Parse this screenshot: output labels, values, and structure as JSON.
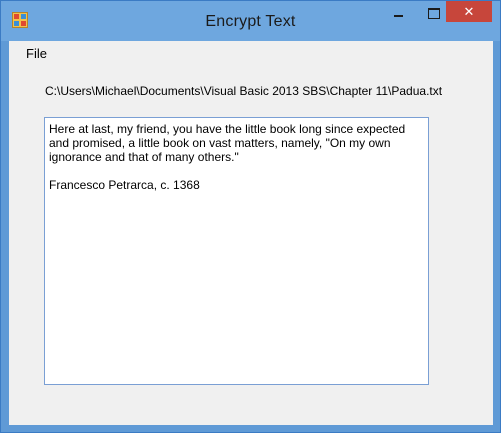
{
  "window": {
    "title": "Encrypt Text",
    "close_glyph": "✕"
  },
  "menu": {
    "items": [
      "File"
    ]
  },
  "file_path": "C:\\Users\\Michael\\Documents\\Visual Basic 2013 SBS\\Chapter 11\\Padua.txt",
  "text_content": {
    "paragraph1": "Here at last, my friend, you have the little book long since expected and promised, a little book on vast matters, namely, \"On my own ignorance and that of many others.\"",
    "paragraph2": "Francesco Petrarca, c. 1368"
  },
  "colors": {
    "title_bar": "#6ea7df",
    "frame": "#5f9ad6",
    "close_button": "#c7463b",
    "client_background": "#f0f0f0",
    "textbox_border": "#7a9fd4"
  },
  "icons": {
    "app": "app-icon",
    "minimize": "minimize-icon",
    "maximize": "maximize-icon",
    "close": "close-icon"
  }
}
